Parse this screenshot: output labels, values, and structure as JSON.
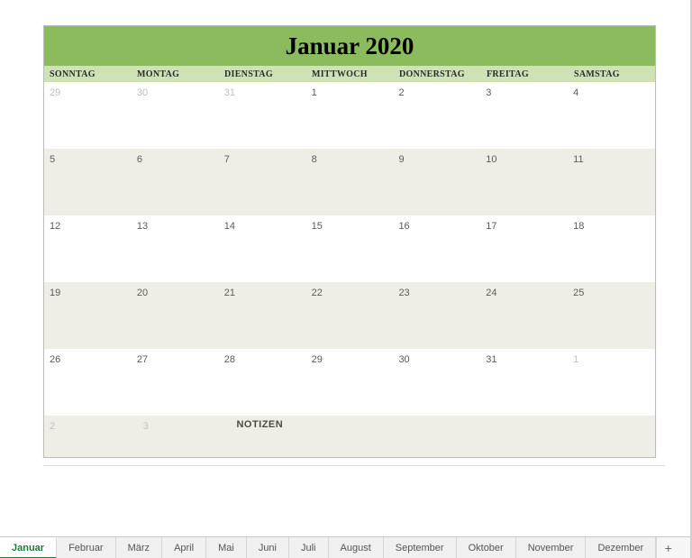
{
  "title": "Januar 2020",
  "dow": [
    "SONNTAG",
    "MONTAG",
    "DIENSTAG",
    "MITTWOCH",
    "DONNERSTAG",
    "FREITAG",
    "SAMSTAG"
  ],
  "weeks": [
    {
      "alt": false,
      "cells": [
        {
          "v": "29",
          "out": true
        },
        {
          "v": "30",
          "out": true
        },
        {
          "v": "31",
          "out": true
        },
        {
          "v": "1",
          "out": false
        },
        {
          "v": "2",
          "out": false
        },
        {
          "v": "3",
          "out": false
        },
        {
          "v": "4",
          "out": false
        }
      ]
    },
    {
      "alt": true,
      "cells": [
        {
          "v": "5",
          "out": false
        },
        {
          "v": "6",
          "out": false
        },
        {
          "v": "7",
          "out": false
        },
        {
          "v": "8",
          "out": false
        },
        {
          "v": "9",
          "out": false
        },
        {
          "v": "10",
          "out": false
        },
        {
          "v": "11",
          "out": false
        }
      ]
    },
    {
      "alt": false,
      "cells": [
        {
          "v": "12",
          "out": false
        },
        {
          "v": "13",
          "out": false
        },
        {
          "v": "14",
          "out": false
        },
        {
          "v": "15",
          "out": false
        },
        {
          "v": "16",
          "out": false
        },
        {
          "v": "17",
          "out": false
        },
        {
          "v": "18",
          "out": false
        }
      ]
    },
    {
      "alt": true,
      "cells": [
        {
          "v": "19",
          "out": false
        },
        {
          "v": "20",
          "out": false
        },
        {
          "v": "21",
          "out": false
        },
        {
          "v": "22",
          "out": false
        },
        {
          "v": "23",
          "out": false
        },
        {
          "v": "24",
          "out": false
        },
        {
          "v": "25",
          "out": false
        }
      ]
    },
    {
      "alt": false,
      "cells": [
        {
          "v": "26",
          "out": false
        },
        {
          "v": "27",
          "out": false
        },
        {
          "v": "28",
          "out": false
        },
        {
          "v": "29",
          "out": false
        },
        {
          "v": "30",
          "out": false
        },
        {
          "v": "31",
          "out": false
        },
        {
          "v": "1",
          "out": true
        }
      ]
    }
  ],
  "notes": {
    "c0": "2",
    "c1": "3",
    "label": "NOTIZEN"
  },
  "tabs": [
    {
      "label": "Januar",
      "active": true
    },
    {
      "label": "Februar",
      "active": false
    },
    {
      "label": "März",
      "active": false
    },
    {
      "label": "April",
      "active": false
    },
    {
      "label": "Mai",
      "active": false
    },
    {
      "label": "Juni",
      "active": false
    },
    {
      "label": "Juli",
      "active": false
    },
    {
      "label": "August",
      "active": false
    },
    {
      "label": "September",
      "active": false
    },
    {
      "label": "Oktober",
      "active": false
    },
    {
      "label": "November",
      "active": false
    },
    {
      "label": "Dezember",
      "active": false
    }
  ],
  "add_tab_glyph": "+"
}
